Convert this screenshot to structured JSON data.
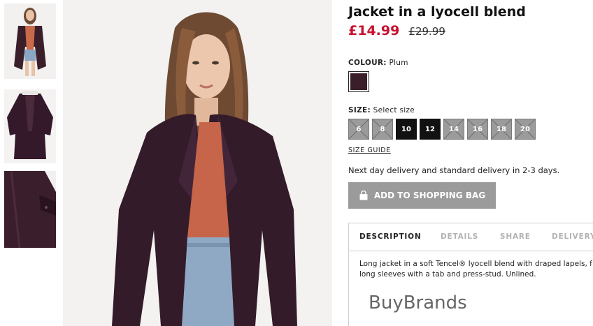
{
  "product": {
    "title": "Jacket in a lyocell blend",
    "price_sale": "£14.99",
    "price_original": "£29.99"
  },
  "colour": {
    "label": "COLOUR:",
    "value": "Plum",
    "swatch_hex": "#3a1f2b"
  },
  "size": {
    "label": "SIZE:",
    "prompt": "Select size",
    "options": [
      {
        "label": "6",
        "available": false
      },
      {
        "label": "8",
        "available": false
      },
      {
        "label": "10",
        "available": true
      },
      {
        "label": "12",
        "available": true
      },
      {
        "label": "14",
        "available": false
      },
      {
        "label": "16",
        "available": false
      },
      {
        "label": "18",
        "available": false
      },
      {
        "label": "20",
        "available": false
      }
    ],
    "guide_link": "SIZE GUIDE"
  },
  "delivery_note": "Next day delivery and standard delivery in 2-3 days.",
  "add_to_bag": {
    "label": "ADD TO SHOPPING BAG",
    "icon": "shopping-bag-icon"
  },
  "tabs": {
    "items": [
      "DESCRIPTION",
      "DETAILS",
      "SHARE",
      "DELIVERY"
    ],
    "active": "DESCRIPTION"
  },
  "description": {
    "line1": "Long jacket in a soft Tencel® lyocell blend with draped lapels, f",
    "line2": "long sleeves with a tab and press-stud. Unlined."
  },
  "watermark": "BuyBrands",
  "colors": {
    "price_sale": "#c8102e",
    "disabled_size": "#9b9b9b",
    "available_size": "#111111",
    "button": "#9b9b9b"
  }
}
